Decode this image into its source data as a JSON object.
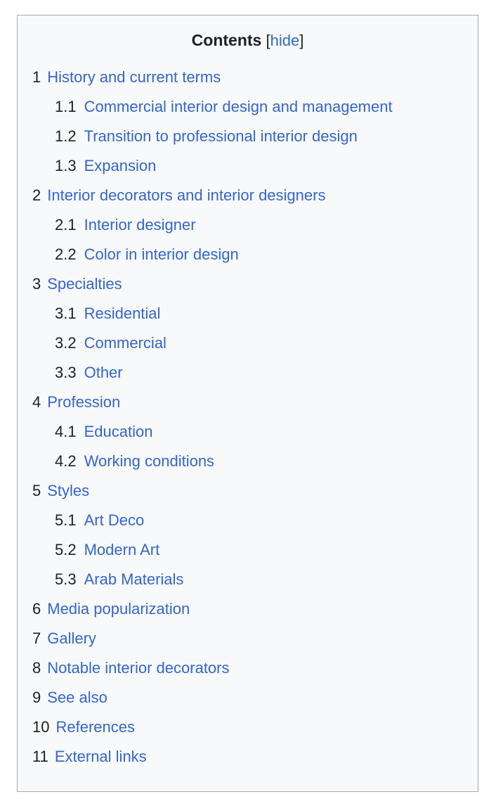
{
  "toc": {
    "title": "Contents",
    "toggle": {
      "open_bracket": "[",
      "label": "hide",
      "close_bracket": "]"
    },
    "link_color": "#3366cc",
    "number_color": "#202122",
    "background_color": "#f8f9fa",
    "border_color": "#a2a9b1",
    "entries": [
      {
        "number": "1",
        "label": "History and current terms",
        "children": [
          {
            "number": "1.1",
            "label": "Commercial interior design and management"
          },
          {
            "number": "1.2",
            "label": "Transition to professional interior design"
          },
          {
            "number": "1.3",
            "label": "Expansion"
          }
        ]
      },
      {
        "number": "2",
        "label": "Interior decorators and interior designers",
        "children": [
          {
            "number": "2.1",
            "label": "Interior designer"
          },
          {
            "number": "2.2",
            "label": "Color in interior design"
          }
        ]
      },
      {
        "number": "3",
        "label": "Specialties",
        "children": [
          {
            "number": "3.1",
            "label": "Residential"
          },
          {
            "number": "3.2",
            "label": "Commercial"
          },
          {
            "number": "3.3",
            "label": "Other"
          }
        ]
      },
      {
        "number": "4",
        "label": "Profession",
        "children": [
          {
            "number": "4.1",
            "label": "Education"
          },
          {
            "number": "4.2",
            "label": "Working conditions"
          }
        ]
      },
      {
        "number": "5",
        "label": "Styles",
        "children": [
          {
            "number": "5.1",
            "label": "Art Deco"
          },
          {
            "number": "5.2",
            "label": "Modern Art"
          },
          {
            "number": "5.3",
            "label": "Arab Materials"
          }
        ]
      },
      {
        "number": "6",
        "label": "Media popularization",
        "children": []
      },
      {
        "number": "7",
        "label": "Gallery",
        "children": []
      },
      {
        "number": "8",
        "label": "Notable interior decorators",
        "children": []
      },
      {
        "number": "9",
        "label": "See also",
        "children": []
      },
      {
        "number": "10",
        "label": "References",
        "children": []
      },
      {
        "number": "11",
        "label": "External links",
        "children": []
      }
    ]
  }
}
